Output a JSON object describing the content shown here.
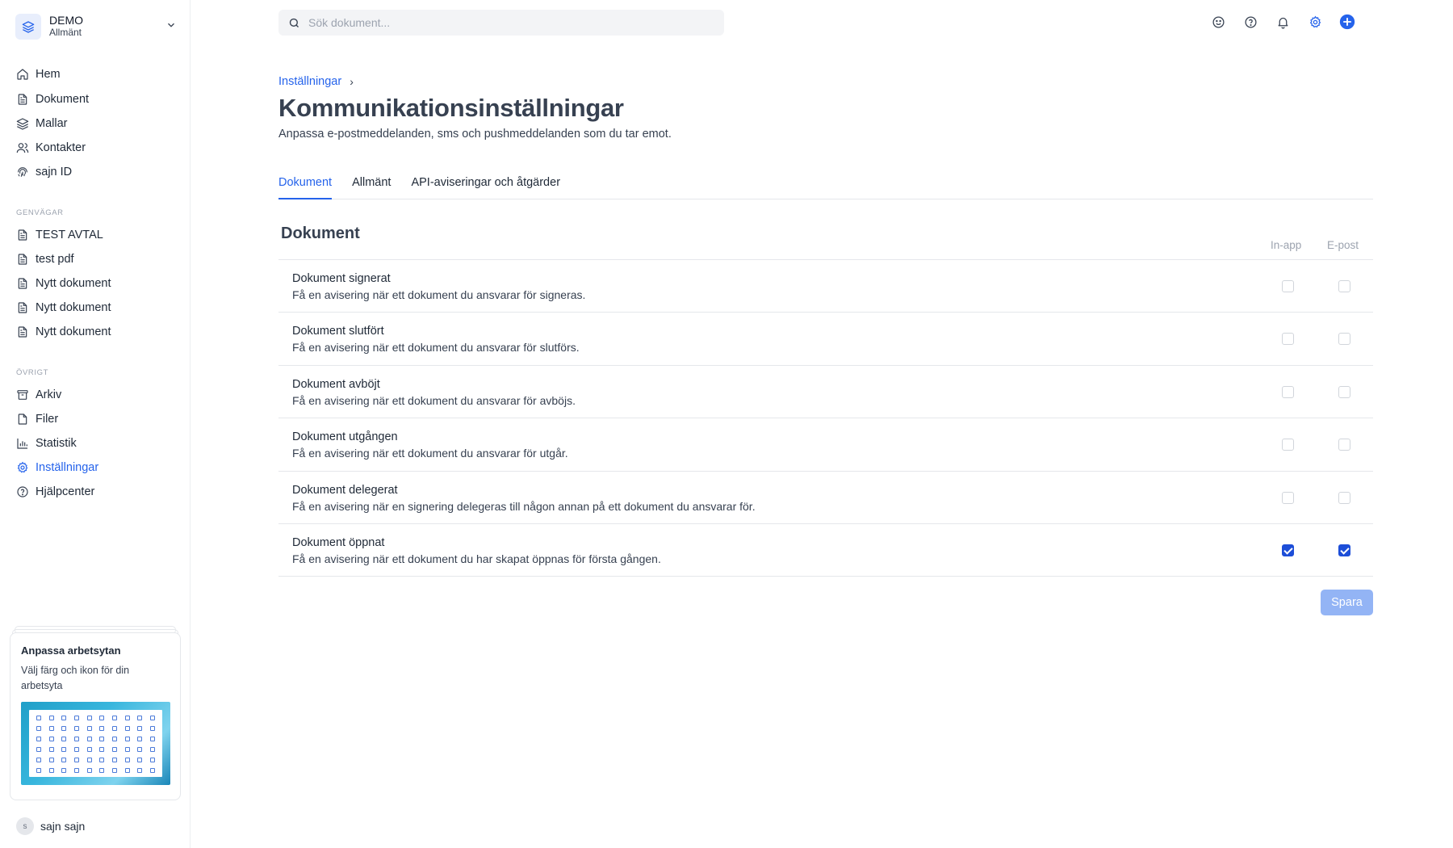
{
  "workspace": {
    "name": "DEMO",
    "sub": "Allmänt"
  },
  "nav": [
    {
      "label": "Hem",
      "icon": "home-icon"
    },
    {
      "label": "Dokument",
      "icon": "document-icon"
    },
    {
      "label": "Mallar",
      "icon": "layers-icon"
    },
    {
      "label": "Kontakter",
      "icon": "users-icon"
    },
    {
      "label": "sajn ID",
      "icon": "fingerprint-icon"
    }
  ],
  "shortcuts": {
    "label": "GENVÄGAR",
    "items": [
      {
        "label": "TEST AVTAL"
      },
      {
        "label": "test pdf"
      },
      {
        "label": "Nytt dokument"
      },
      {
        "label": "Nytt dokument"
      },
      {
        "label": "Nytt dokument"
      }
    ]
  },
  "other": {
    "label": "ÖVRIGT",
    "items": [
      {
        "label": "Arkiv",
        "icon": "archive-icon"
      },
      {
        "label": "Filer",
        "icon": "file-icon"
      },
      {
        "label": "Statistik",
        "icon": "chart-icon"
      },
      {
        "label": "Inställningar",
        "icon": "gear-icon",
        "active": true
      },
      {
        "label": "Hjälpcenter",
        "icon": "help-icon"
      }
    ]
  },
  "promo": {
    "title": "Anpassa arbetsytan",
    "text": "Välj färg och ikon för din arbetsyta"
  },
  "user": {
    "initial": "s",
    "name": "sajn sajn"
  },
  "search": {
    "placeholder": "Sök dokument..."
  },
  "breadcrumb": {
    "parent": "Inställningar",
    "separator": "›"
  },
  "page": {
    "title": "Kommunikationsinställningar",
    "subtitle": "Anpassa e-postmeddelanden, sms och pushmeddelanden som du tar emot."
  },
  "tabs": [
    {
      "label": "Dokument",
      "active": true
    },
    {
      "label": "Allmänt"
    },
    {
      "label": "API-aviseringar och åtgärder"
    }
  ],
  "section": {
    "title": "Dokument",
    "col_inapp": "In-app",
    "col_email": "E-post"
  },
  "rows": [
    {
      "title": "Dokument signerat",
      "desc": "Få en avisering när ett dokument du ansvarar för signeras.",
      "inapp": false,
      "email": false
    },
    {
      "title": "Dokument slutfört",
      "desc": "Få en avisering när ett dokument du ansvarar för slutförs.",
      "inapp": false,
      "email": false
    },
    {
      "title": "Dokument avböjt",
      "desc": "Få en avisering när ett dokument du ansvarar för avböjs.",
      "inapp": false,
      "email": false
    },
    {
      "title": "Dokument utgången",
      "desc": "Få en avisering när ett dokument du ansvarar för utgår.",
      "inapp": false,
      "email": false
    },
    {
      "title": "Dokument delegerat",
      "desc": "Få en avisering när en signering delegeras till någon annan på ett dokument du ansvarar för.",
      "inapp": false,
      "email": false
    },
    {
      "title": "Dokument öppnat",
      "desc": "Få en avisering när ett dokument du har skapat öppnas för första gången.",
      "inapp": true,
      "email": true
    }
  ],
  "save_label": "Spara",
  "colors": {
    "accent": "#2563eb",
    "save_disabled": "#93b4f5"
  }
}
